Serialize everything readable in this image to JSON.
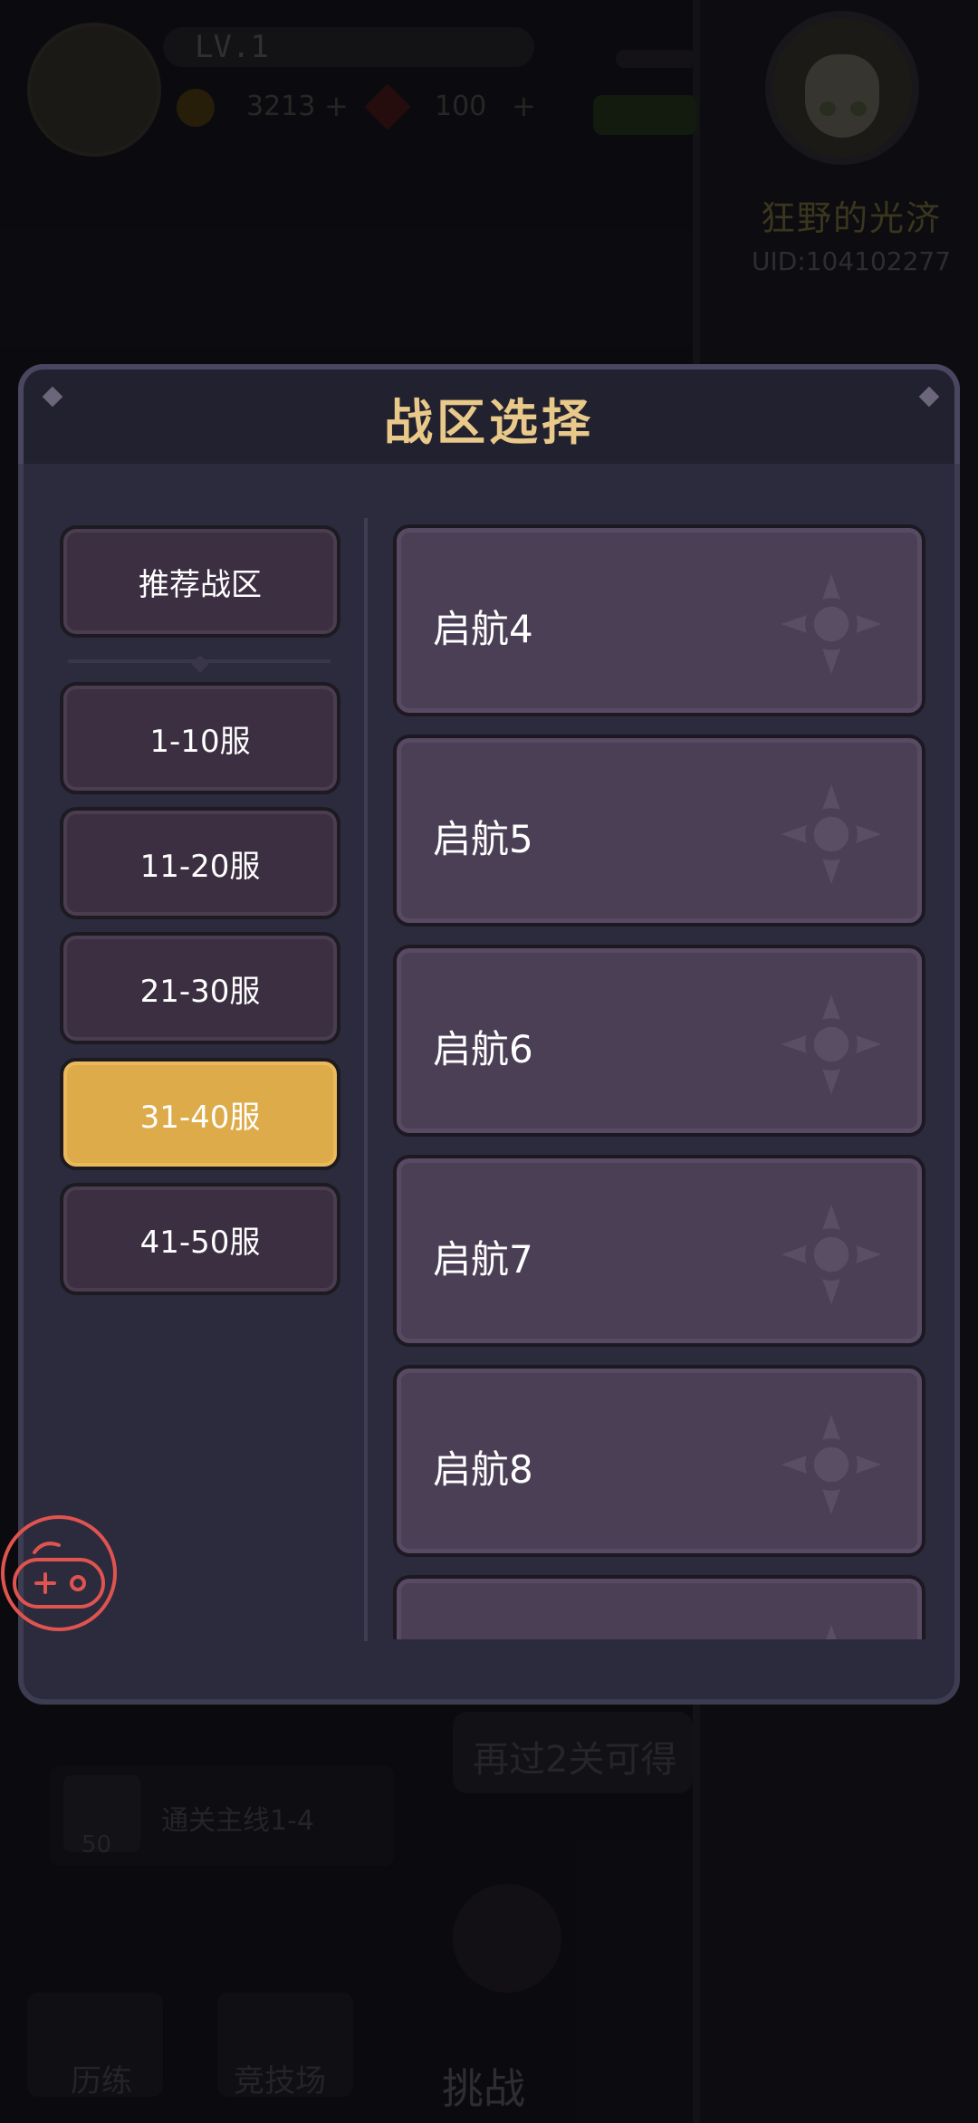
{
  "background": {
    "level": "LV.1",
    "coins": "3213",
    "gems": "100",
    "player_name": "狂野的光济",
    "player_uid": "UID:104102277",
    "hint_text": "再过2关可得",
    "reward_count": "50",
    "reward_text": "通关主线1-4",
    "nav": [
      "历练",
      "竞技场",
      "挑战"
    ]
  },
  "modal": {
    "title": "战区选择",
    "tabs": [
      {
        "label": "推荐战区",
        "active": false
      },
      {
        "label": "1-10服",
        "active": false
      },
      {
        "label": "11-20服",
        "active": false
      },
      {
        "label": "21-30服",
        "active": false
      },
      {
        "label": "31-40服",
        "active": true
      },
      {
        "label": "41-50服",
        "active": false
      }
    ],
    "servers": [
      {
        "name": "启航4"
      },
      {
        "name": "启航5"
      },
      {
        "name": "启航6"
      },
      {
        "name": "启航7"
      },
      {
        "name": "启航8"
      },
      {
        "name": ""
      }
    ]
  },
  "colors": {
    "title": "#e9c98a",
    "active_tab": "#ddab4a",
    "card": "#4b3f56",
    "float_button": "#e0544f"
  }
}
